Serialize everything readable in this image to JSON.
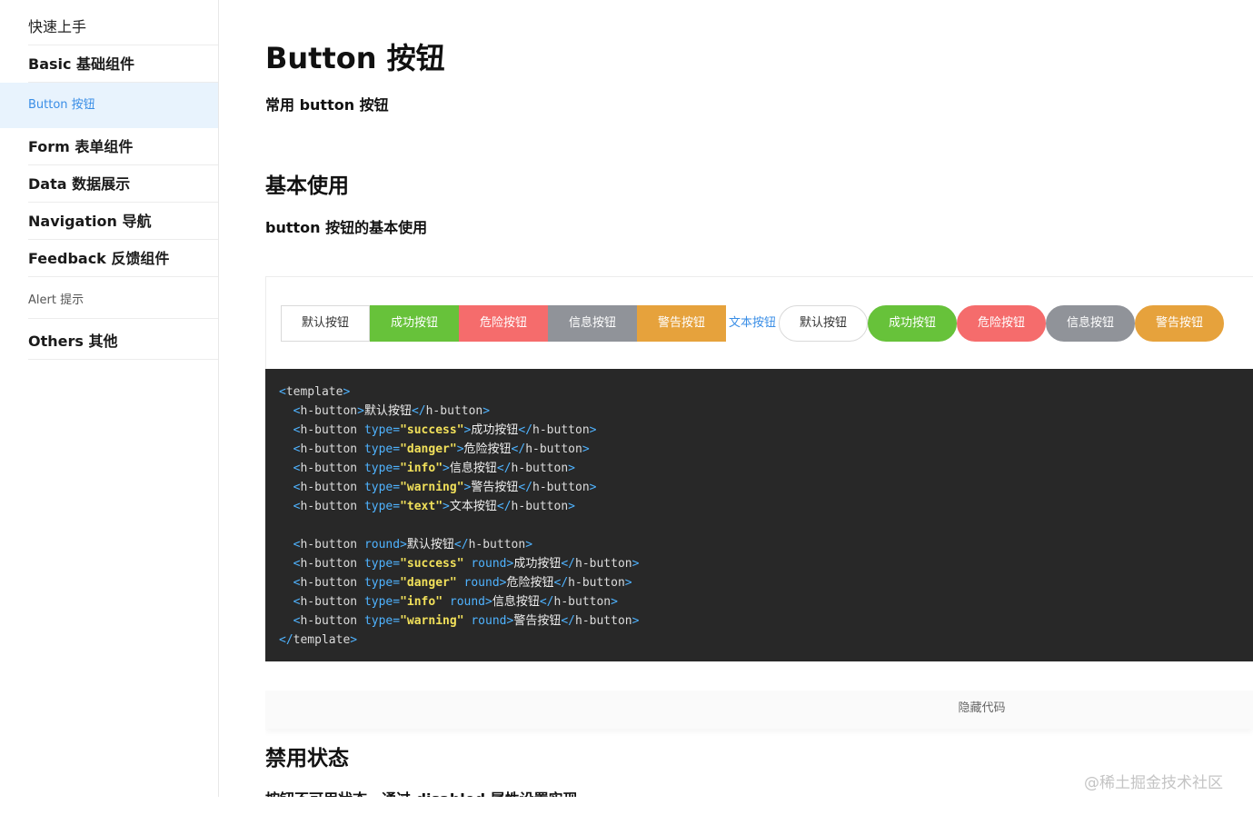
{
  "sidebar": {
    "quick_start": "快速上手",
    "basic": "Basic 基础组件",
    "button": "Button 按钮",
    "form": "Form 表单组件",
    "data": "Data 数据展示",
    "navigation": "Navigation 导航",
    "feedback": "Feedback 反馈组件",
    "alert": "Alert 提示",
    "others": "Others 其他"
  },
  "page": {
    "title": "Button 按钮",
    "description": "常用 button 按钮"
  },
  "section_basic": {
    "title": "基本使用",
    "description": "button 按钮的基本使用"
  },
  "demo_buttons": {
    "default": "默认按钮",
    "success": "成功按钮",
    "danger": "危险按钮",
    "info": "信息按钮",
    "warning": "警告按钮",
    "text": "文本按钮",
    "round_default": "默认按钮",
    "round_success": "成功按钮",
    "round_danger": "危险按钮",
    "round_info": "信息按钮",
    "round_warning": "警告按钮"
  },
  "code": {
    "open_template": "template",
    "close_template": "template",
    "tag": "h-button",
    "attr_type": "type",
    "attr_round": "round",
    "lines": [
      {
        "type": "",
        "round": false,
        "text": "默认按钮"
      },
      {
        "type": "\"success\"",
        "round": false,
        "text": "成功按钮"
      },
      {
        "type": "\"danger\"",
        "round": false,
        "text": "危险按钮"
      },
      {
        "type": "\"info\"",
        "round": false,
        "text": "信息按钮"
      },
      {
        "type": "\"warning\"",
        "round": false,
        "text": "警告按钮"
      },
      {
        "type": "\"text\"",
        "round": false,
        "text": "文本按钮"
      },
      {
        "type": "",
        "round": true,
        "text": "默认按钮"
      },
      {
        "type": "\"success\"",
        "round": true,
        "text": "成功按钮"
      },
      {
        "type": "\"danger\"",
        "round": true,
        "text": "危险按钮"
      },
      {
        "type": "\"info\"",
        "round": true,
        "text": "信息按钮"
      },
      {
        "type": "\"warning\"",
        "round": true,
        "text": "警告按钮"
      }
    ]
  },
  "toggle_code": "隐藏代码",
  "section_disabled": {
    "title": "禁用状态",
    "description": "按钮不可用状态，通过 disabled 属性设置实现"
  },
  "watermark": "@稀土掘金技术社区",
  "colors": {
    "primary": "#3a8ee6",
    "success": "#67c23a",
    "danger": "#f56c6c",
    "info": "#909399",
    "warning": "#e6a23c",
    "code_bg": "#282828"
  }
}
